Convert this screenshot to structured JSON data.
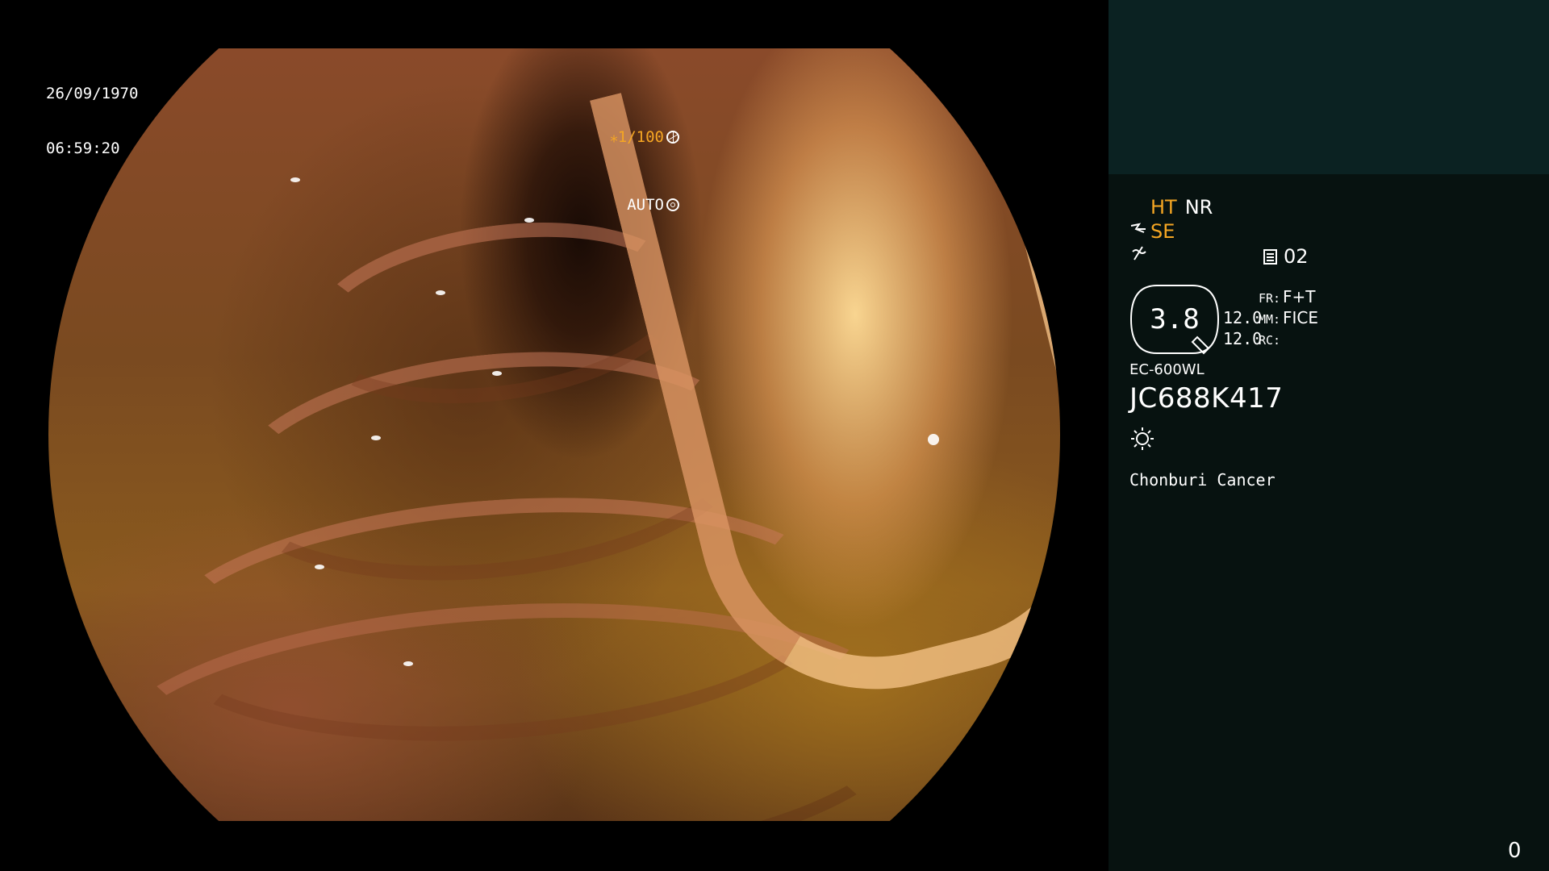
{
  "image_overlay": {
    "date": "26/09/1970",
    "time": "06:59:20",
    "shutter": "⁎1/100",
    "iris_mode": "AUTO"
  },
  "panel": {
    "ht_label": "HT",
    "nr_label": "NR",
    "se_label": "SE",
    "channel": "02",
    "zoom": "3.8",
    "param_rows": [
      {
        "num": "",
        "label": "FR:",
        "value": "F+T"
      },
      {
        "num": "12.0",
        "label": "MM:",
        "value": "FICE"
      },
      {
        "num": "12.0",
        "label": "RC:",
        "value": ""
      }
    ],
    "scope_model": "EC-600WL",
    "scope_serial": "JC688K417",
    "hospital": "Chonburi Cancer",
    "counter": "0"
  },
  "colors": {
    "accent": "#f5a623",
    "panel_bg": "#071210",
    "panel_header": "#0b2222"
  },
  "icons": {
    "shutter_icon": "aperture-icon",
    "iris_icon": "iris-icon",
    "structure_icon": "structure-enhance-icon",
    "filter_icon": "no-filter-icon",
    "channel_icon": "memory-channel-icon",
    "light_icon": "light-source-icon"
  }
}
